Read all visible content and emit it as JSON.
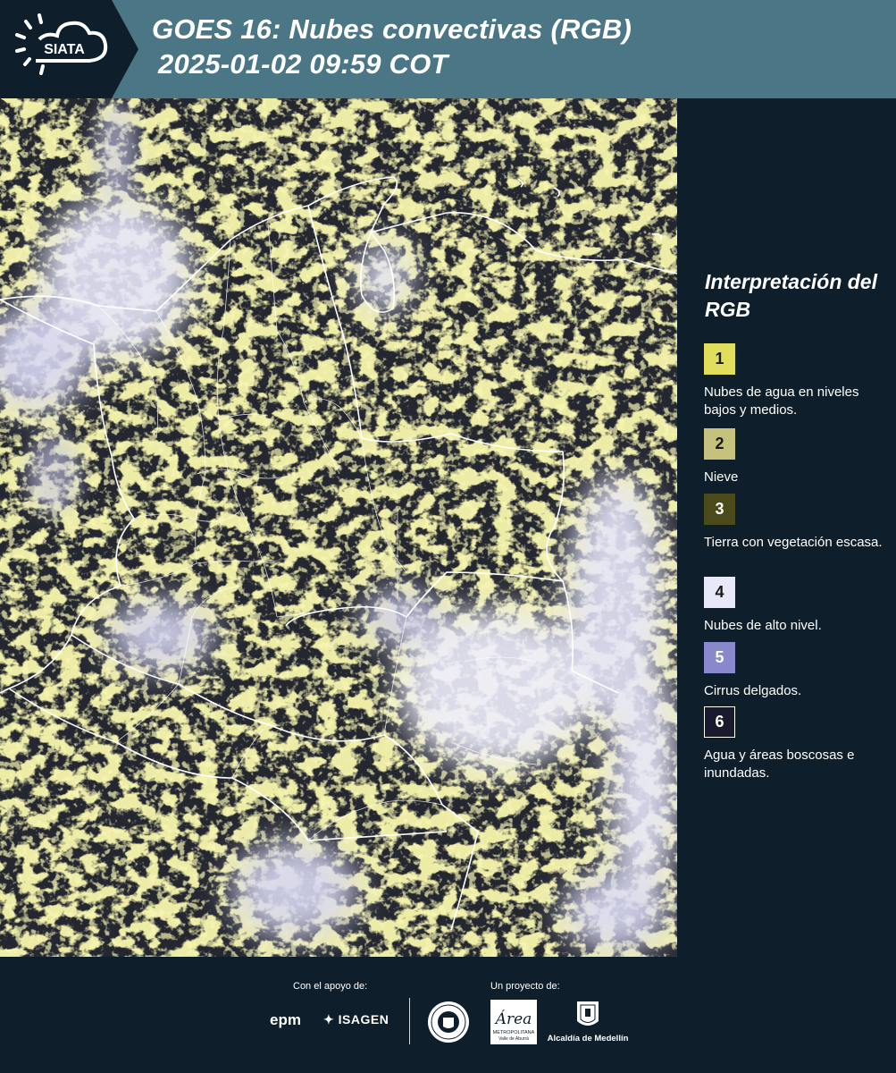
{
  "header": {
    "logo_text": "SIATA",
    "title_line1": "GOES 16: Nubes convectivas (RGB)",
    "title_line2": "2025-01-02 09:59 COT"
  },
  "legend": {
    "title": "Interpretación del RGB",
    "items": [
      {
        "number": "1",
        "label": "Nubes de agua en niveles bajos y medios.",
        "color": "#e0de5a"
      },
      {
        "number": "2",
        "label": "Nieve",
        "color": "#c4c27c"
      },
      {
        "number": "3",
        "label": "Tierra con vegetación escasa.",
        "color": "#4a4a1a"
      },
      {
        "number": "4",
        "label": "Nubes de alto nivel.",
        "color": "#e8e8f8"
      },
      {
        "number": "5",
        "label": "Cirrus delgados.",
        "color": "#8a88cc"
      },
      {
        "number": "6",
        "label": "Agua y áreas boscosas e inundadas.",
        "color": "#1a1a2e"
      }
    ]
  },
  "footer": {
    "support_label": "Con el apoyo de:",
    "project_label": "Un proyecto de:",
    "sponsors": [
      "epm",
      "ISAGEN"
    ],
    "partners": {
      "area_name": "Área",
      "area_sub1": "METROPOLITANA",
      "area_sub2": "Valle de Aburrá",
      "alcaldia": "Alcaldía de Medellín"
    }
  },
  "colors": {
    "header_bg": "#4a7685",
    "page_bg": "#0e1f2b",
    "cloud_yellow": "#d6d45c",
    "high_cloud": "#e6e6fa",
    "background_dark": "#1c2038"
  },
  "icons": [
    "siata-sun-cloud-icon",
    "medellin-seal-icon",
    "alcaldia-shield-icon",
    "isagen-star-icon"
  ]
}
